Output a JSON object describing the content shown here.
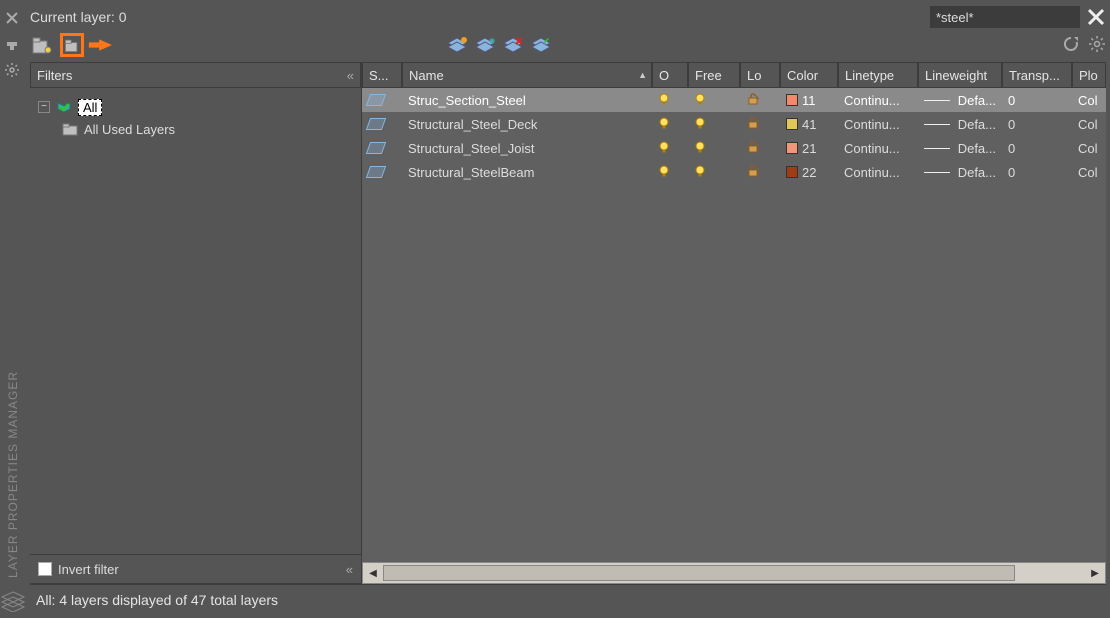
{
  "verticalTitle": "LAYER PROPERTIES MANAGER",
  "titlebar": {
    "currentLayerLabel": "Current layer:",
    "currentLayerValue": "0"
  },
  "search": {
    "value": "*steel*"
  },
  "filtersHeader": "Filters",
  "tree": {
    "rootLabel": "All",
    "childLabel": "All Used Layers"
  },
  "invertFilter": {
    "label": "Invert filter",
    "checked": false
  },
  "columns": {
    "s": "S...",
    "name": "Name",
    "on": "O",
    "free": "Free",
    "lock": "Lo",
    "color": "Color",
    "linetype": "Linetype",
    "lineweight": "Lineweight",
    "trans": "Transp...",
    "plot": "Plo"
  },
  "rows": [
    {
      "selected": true,
      "name": "Struc_Section_Steel",
      "on": true,
      "free": true,
      "locked": false,
      "color_swatch": "#f4886b",
      "color_num": "11",
      "linetype": "Continu...",
      "lineweight": "Defa...",
      "trans": "0",
      "plot": "Col"
    },
    {
      "selected": false,
      "name": "Structural_Steel_Deck",
      "on": true,
      "free": true,
      "locked": false,
      "color_swatch": "#e0c858",
      "color_num": "41",
      "linetype": "Continu...",
      "lineweight": "Defa...",
      "trans": "0",
      "plot": "Col"
    },
    {
      "selected": false,
      "name": "Structural_Steel_Joist",
      "on": true,
      "free": true,
      "locked": false,
      "color_swatch": "#f09878",
      "color_num": "21",
      "linetype": "Continu...",
      "lineweight": "Defa...",
      "trans": "0",
      "plot": "Col"
    },
    {
      "selected": false,
      "name": "Structural_SteelBeam",
      "on": true,
      "free": true,
      "locked": false,
      "color_swatch": "#a03c14",
      "color_num": "22",
      "linetype": "Continu...",
      "lineweight": "Defa...",
      "trans": "0",
      "plot": "Col"
    }
  ],
  "status": "All: 4 layers displayed of 47 total layers"
}
